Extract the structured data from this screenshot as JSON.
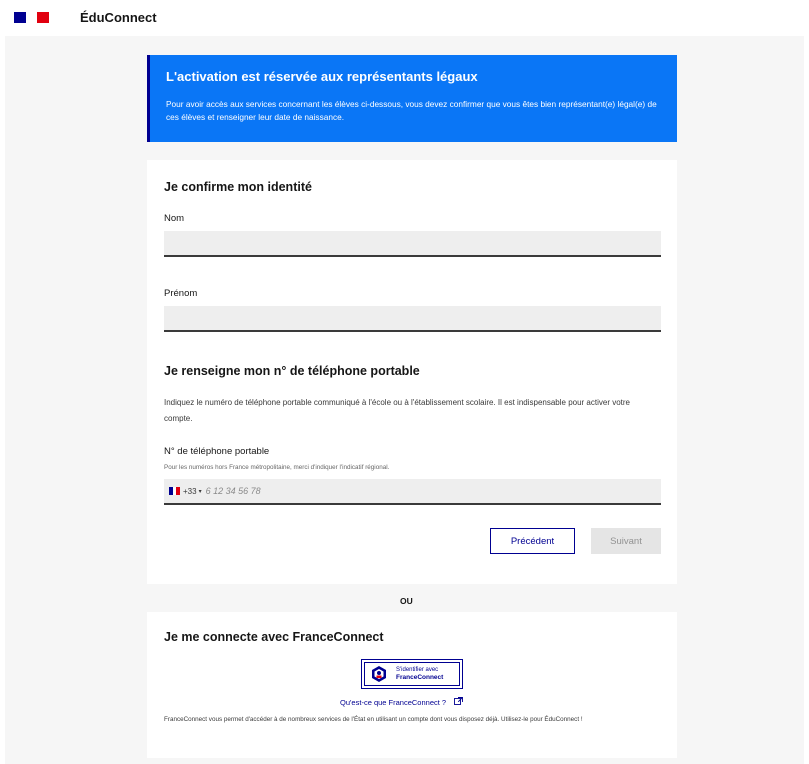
{
  "header": {
    "app_name": "ÉduConnect",
    "flag_colors": [
      "#000091",
      "#ffffff",
      "#e1000f"
    ]
  },
  "banner": {
    "title": "L'activation est réservée aux représentants légaux",
    "text": "Pour avoir accès aux services concernant les élèves ci-dessous, vous devez confirmer que vous êtes bien représentant(e) légal(e) de ces élèves et renseigner leur date de naissance.",
    "color": "#0a76f6"
  },
  "identity": {
    "heading": "Je confirme mon identité",
    "nom_label": "Nom",
    "nom_value": "",
    "prenom_label": "Prénom",
    "prenom_value": ""
  },
  "phone": {
    "heading": "Je renseigne mon n° de téléphone portable",
    "help_text": "Indiquez le numéro de téléphone portable communiqué à l'école ou à l'établissement scolaire. Il est indispensable pour activer votre compte.",
    "label": "N° de téléphone portable",
    "hint": "Pour les numéros hors France métropolitaine, merci d'indiquer l'indicatif régional.",
    "country_code": "+33",
    "placeholder": "6 12 34 56 78",
    "value": ""
  },
  "actions": {
    "prev_label": "Précédent",
    "next_label": "Suivant"
  },
  "separator": "OU",
  "franceconnect": {
    "heading": "Je me connecte avec FranceConnect",
    "button_line1": "S'identifier avec",
    "button_line2": "FranceConnect",
    "link_text": "Qu'est-ce que FranceConnect ?",
    "description": "FranceConnect vous permet d'accéder à de nombreux services de l'État en utilisant un compte dont vous disposez déjà. Utilisez-le pour ÉduConnect !"
  }
}
